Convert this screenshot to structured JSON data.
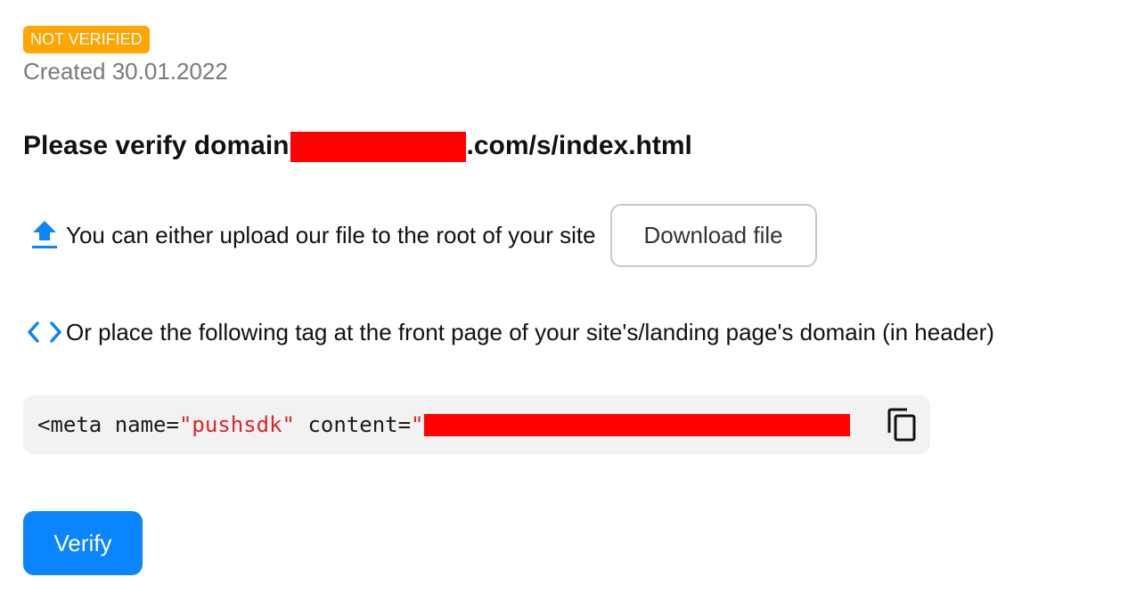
{
  "status": {
    "badge_label": "NOT VERIFIED",
    "badge_color": "#ffa500",
    "created_text": "Created 30.01.2022"
  },
  "heading": {
    "prefix": "Please verify domain",
    "suffix": ".com/s/index.html",
    "redaction_color": "#ff0000"
  },
  "upload_option": {
    "icon": "upload-arrow-icon",
    "text": "You can either upload our file to the root of your site",
    "button_label": "Download file"
  },
  "tag_option": {
    "icon": "code-brackets-icon",
    "text": "Or place the following tag at the front page of your site's/landing page's domain (in header)"
  },
  "code_snippet": {
    "tag_open": "<meta",
    "attr_name": "name=",
    "name_value": "\"pushsdk\"",
    "attr_content": "content=",
    "content_quote": "\"",
    "string_color": "#e0252b",
    "background": "#f2f2f2",
    "copy_icon": "copy-icon"
  },
  "actions": {
    "verify_label": "Verify",
    "verify_color": "#0a84ff"
  },
  "colors": {
    "accent": "#0a84ff",
    "muted_text": "#7a7a7a"
  }
}
